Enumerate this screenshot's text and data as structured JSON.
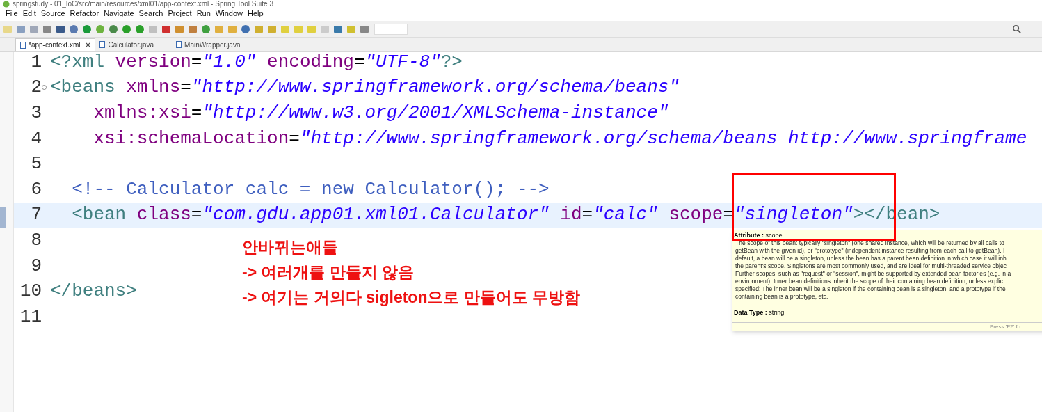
{
  "window": {
    "title": "springstudy - 01_IoC/src/main/resources/xml01/app-context.xml - Spring Tool Suite 3"
  },
  "menu": [
    "File",
    "Edit",
    "Source",
    "Refactor",
    "Navigate",
    "Search",
    "Project",
    "Run",
    "Window",
    "Help"
  ],
  "tabs": [
    {
      "label": "*app-context.xml",
      "selected": true,
      "closable": true
    },
    {
      "label": "Calculator.java",
      "selected": false,
      "closable": false
    },
    {
      "label": "MainWrapper.java",
      "selected": false,
      "closable": false
    }
  ],
  "editor": {
    "lines": [
      {
        "number": "1",
        "current": false,
        "foldable": false,
        "tokens": [
          {
            "kind": "tag",
            "text": "<?xml"
          },
          {
            "kind": "attr",
            "text": " version"
          },
          {
            "kind": "plain",
            "text": "="
          },
          {
            "kind": "value",
            "text": "\"1.0\""
          },
          {
            "kind": "attr",
            "text": " encoding"
          },
          {
            "kind": "plain",
            "text": "="
          },
          {
            "kind": "value",
            "text": "\"UTF-8\""
          },
          {
            "kind": "tag",
            "text": "?>"
          }
        ]
      },
      {
        "number": "2",
        "current": false,
        "foldable": true,
        "tokens": [
          {
            "kind": "tag",
            "text": "<beans"
          },
          {
            "kind": "attr",
            "text": " xmlns"
          },
          {
            "kind": "plain",
            "text": "="
          },
          {
            "kind": "value",
            "text": "\"http://www.springframework.org/schema/beans\""
          }
        ]
      },
      {
        "number": "3",
        "current": false,
        "foldable": false,
        "tokens": [
          {
            "kind": "attr",
            "text": "    xmlns:xsi"
          },
          {
            "kind": "plain",
            "text": "="
          },
          {
            "kind": "value",
            "text": "\"http://www.w3.org/2001/XMLSchema-instance\""
          }
        ]
      },
      {
        "number": "4",
        "current": false,
        "foldable": false,
        "tokens": [
          {
            "kind": "attr",
            "text": "    xsi:schemaLocation"
          },
          {
            "kind": "plain",
            "text": "="
          },
          {
            "kind": "value",
            "text": "\"http://www.springframework.org/schema/beans http://www.springframe"
          }
        ]
      },
      {
        "number": "5",
        "current": false,
        "foldable": false
      },
      {
        "number": "6",
        "current": false,
        "foldable": false,
        "tokens": [
          {
            "kind": "comment",
            "text": "  <!-- Calculator calc = new Calculator(); -->"
          }
        ]
      },
      {
        "number": "7",
        "current": true,
        "foldable": false,
        "tokens": [
          {
            "kind": "tag",
            "text": "  <bean"
          },
          {
            "kind": "attr",
            "text": " class"
          },
          {
            "kind": "plain",
            "text": "="
          },
          {
            "kind": "value",
            "text": "\"com.gdu.app01.xml01.Calculator\""
          },
          {
            "kind": "attr",
            "text": " id"
          },
          {
            "kind": "plain",
            "text": "="
          },
          {
            "kind": "value",
            "text": "\"calc\""
          },
          {
            "kind": "attr",
            "text": " scope"
          },
          {
            "kind": "plain",
            "text": "="
          },
          {
            "kind": "value",
            "text": "\"singleton\""
          },
          {
            "kind": "tag",
            "text": "></bean>"
          }
        ]
      },
      {
        "number": "8",
        "current": false,
        "foldable": false
      },
      {
        "number": "9",
        "current": false,
        "foldable": false
      },
      {
        "number": "10",
        "current": false,
        "foldable": false,
        "tokens": [
          {
            "kind": "tag",
            "text": "</beans>"
          }
        ]
      },
      {
        "number": "11",
        "current": false,
        "foldable": false
      }
    ]
  },
  "annotation": [
    "안바뀌는애들",
    "-> 여러개를 만들지 않음",
    "-> 여기는 거의다 sigleton으로 만들어도 무방함"
  ],
  "tooltip": {
    "heading_label": "Attribute :",
    "heading_value": "scope",
    "lines": [
      "The scope of this bean: typically \"singleton\" (one shared instance, which will be returned by all calls to",
      "getBean with the given id), or \"prototype\" (independent instance resulting from each call to getBean). I",
      "default, a bean will be a singleton, unless the bean has a parent bean definition in which case it will inh",
      "the parent's scope. Singletons are most commonly used, and are ideal for multi-threaded service objec",
      "Further scopes, such as \"request\" or \"session\", might be supported by extended bean factories (e.g. in a",
      "environment). Inner bean definitions inherit the scope of their containing bean definition, unless explic",
      "specified: The inner bean will be a singleton if the containing bean is a singleton, and a prototype if the",
      "containing bean is a prototype, etc."
    ],
    "type_label": "Data Type :",
    "type_value": "string",
    "footer": "Press 'F2' fo"
  }
}
